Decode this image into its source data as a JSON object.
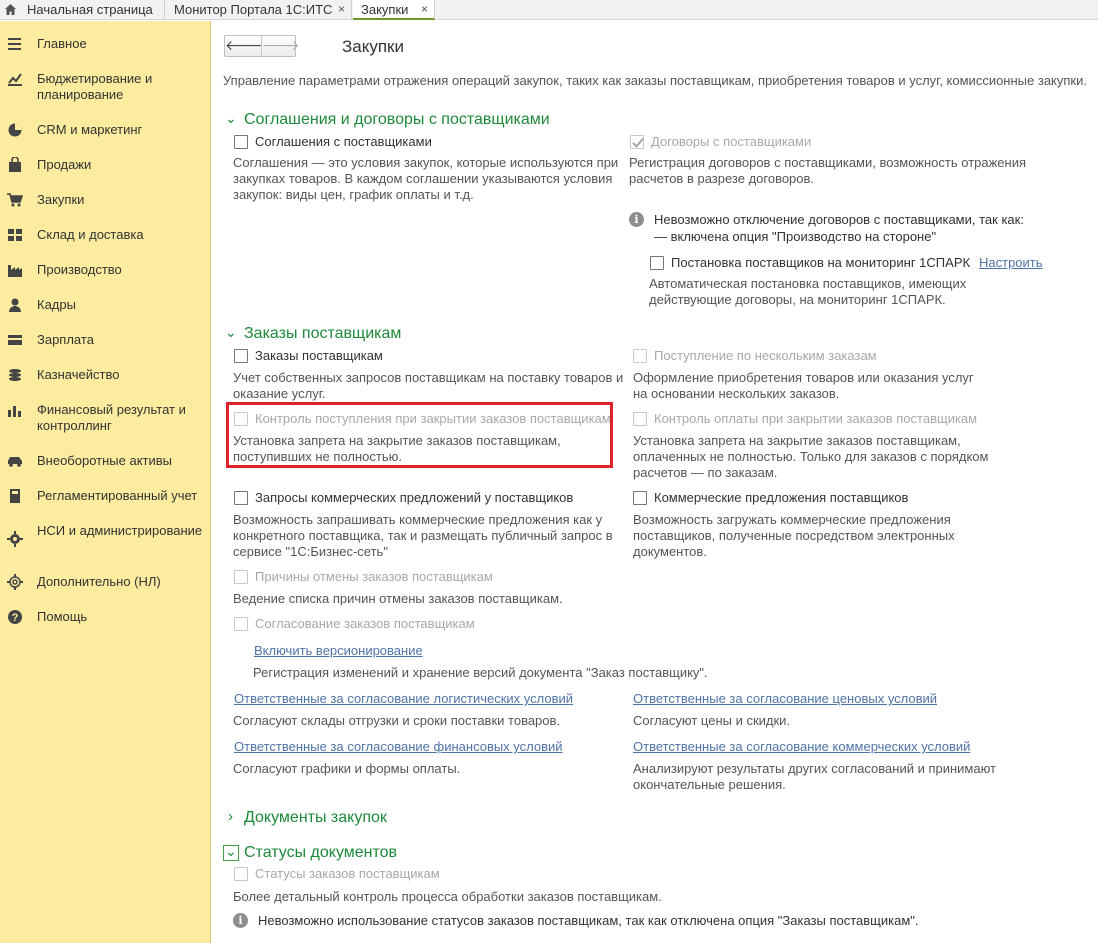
{
  "tabs": [
    {
      "label": "Начальная страница",
      "closable": false
    },
    {
      "label": "Монитор Портала 1С:ИТС",
      "closable": true
    },
    {
      "label": "Закупки",
      "closable": true,
      "active": true
    }
  ],
  "close_glyph": "×",
  "sidebar": [
    {
      "label": "Главное",
      "icon": "menu-icon"
    },
    {
      "label": "Бюджетирование и планирование",
      "icon": "budget-icon"
    },
    {
      "label": "CRM и маркетинг",
      "icon": "pie-chart-icon"
    },
    {
      "label": "Продажи",
      "icon": "bag-icon"
    },
    {
      "label": "Закупки",
      "icon": "cart-icon"
    },
    {
      "label": "Склад и доставка",
      "icon": "warehouse-icon"
    },
    {
      "label": "Производство",
      "icon": "factory-icon"
    },
    {
      "label": "Кадры",
      "icon": "person-icon"
    },
    {
      "label": "Зарплата",
      "icon": "wallet-icon"
    },
    {
      "label": "Казначейство",
      "icon": "coins-icon"
    },
    {
      "label": "Финансовый результат и контроллинг",
      "icon": "bar-chart-icon"
    },
    {
      "label": "Внеоборотные активы",
      "icon": "car-icon"
    },
    {
      "label": "Регламентированный учет",
      "icon": "calculator-icon"
    },
    {
      "label": "НСИ и администрирование",
      "icon": "gear-icon"
    },
    {
      "label": "Дополнительно (НЛ)",
      "icon": "gear-outline-icon"
    },
    {
      "label": "Помощь",
      "icon": "help-icon"
    }
  ],
  "page": {
    "nav_back": "🡐",
    "nav_forward": "🡒",
    "title": "Закупки",
    "intro": "Управление параметрами отражения операций закупок, таких как заказы поставщикам, приобретения товаров и услуг, комиссионные закупки."
  },
  "sections": {
    "s1": {
      "title": "Соглашения и договоры с поставщиками",
      "cb_agreements": "Соглашения с поставщиками",
      "desc_agreements": "Соглашения — это условия закупок, которые используются при закупках товаров. В каждом соглашении указываются условия закупок: виды цен, график оплаты и т.д.",
      "cb_contracts": "Договоры с поставщиками",
      "desc_contracts": "Регистрация договоров с поставщиками, возможность отражения расчетов в разрезе договоров.",
      "info_line1": "Невозможно отключение договоров с поставщиками, так как:",
      "info_line2": "— включена опция \"Производство на стороне\"",
      "cb_monitoring": "Постановка поставщиков на мониторинг 1СПАРК",
      "link_setup": "Настроить",
      "desc_monitoring": "Автоматическая постановка поставщиков, имеющих действующие договоры, на мониторинг 1СПАРК."
    },
    "s2": {
      "title": "Заказы поставщикам",
      "cb_orders": "Заказы поставщикам",
      "desc_orders": "Учет собственных запросов поставщикам на поставку товаров и оказание услуг.",
      "cb_multi": "Поступление по нескольким заказам",
      "desc_multi": "Оформление приобретения товаров или оказания услуг на основании нескольких заказов.",
      "cb_control_receipt": "Контроль поступления при закрытии заказов поставщикам",
      "desc_control_receipt": "Установка запрета на закрытие заказов поставщикам, поступивших не полностью.",
      "cb_control_payment": "Контроль оплаты при закрытии заказов поставщикам",
      "desc_control_payment": "Установка запрета на закрытие заказов поставщикам, оплаченных не полностью. Только для заказов с порядком расчетов — по заказам.",
      "cb_requests": "Запросы коммерческих предложений у поставщиков",
      "desc_requests": "Возможность запрашивать коммерческие предложения как у конкретного поставщика, так и размещать публичный запрос в сервисе \"1С:Бизнес-сеть\"",
      "cb_offers": "Коммерческие предложения поставщиков",
      "desc_offers": "Возможность загружать коммерческие предложения поставщиков, полученные посредством электронных документов.",
      "cb_reasons": "Причины отмены заказов поставщикам",
      "desc_reasons": "Ведение списка причин отмены заказов поставщикам.",
      "cb_approval": "Согласование заказов поставщикам",
      "link_versioning": "Включить версионирование",
      "desc_versioning": "Регистрация изменений и хранение версий документа \"Заказ поставщику\".",
      "link_logistics": "Ответственные за согласование логистических условий",
      "desc_logistics": "Согласуют склады отгрузки и сроки поставки товаров.",
      "link_prices": "Ответственные за согласование ценовых условий",
      "desc_prices": "Согласуют цены и скидки.",
      "link_finance": "Ответственные за согласование финансовых условий",
      "desc_finance": "Согласуют графики и формы оплаты.",
      "link_commercial": "Ответственные за согласование коммерческих условий",
      "desc_commercial": "Анализируют результаты других согласований и принимают окончательные решения."
    },
    "s3": {
      "title": "Документы закупок"
    },
    "s4": {
      "title": "Статусы документов",
      "cb_statuses": "Статусы заказов поставщикам",
      "desc_statuses": "Более детальный контроль процесса обработки заказов поставщикам.",
      "info_statuses": "Невозможно использование статусов заказов поставщикам, так как отключена опция \"Заказы поставщикам\"."
    }
  },
  "colors": {
    "sidebar_bg": "#fbec9f",
    "section_green": "#1d8a3a",
    "link_blue": "#4f74a7",
    "highlight_red": "#e0202a"
  }
}
